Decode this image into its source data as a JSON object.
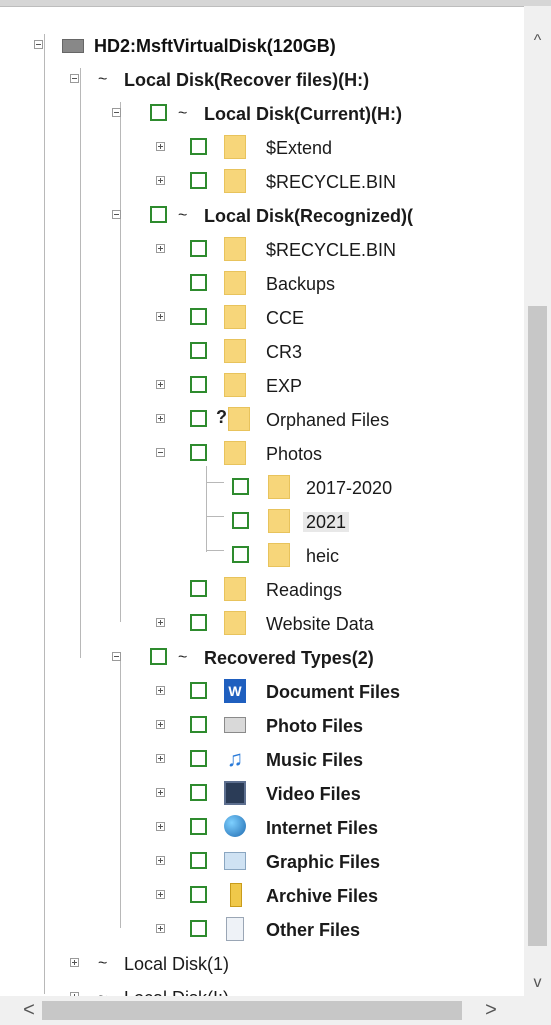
{
  "tree": {
    "root": {
      "label": "HD2:MsftVirtualDisk(120GB)"
    },
    "recover_files": {
      "label": "Local Disk(Recover files)(H:)"
    },
    "current": {
      "label": "Local Disk(Current)(H:)",
      "children": [
        "$Extend",
        "$RECYCLE.BIN"
      ]
    },
    "recognized": {
      "label": "Local Disk(Recognized)(",
      "children": [
        "$RECYCLE.BIN",
        "Backups",
        "CCE",
        "CR3",
        "EXP",
        "Orphaned Files",
        "Photos",
        "2017-2020",
        "2021",
        "heic",
        "Readings",
        "Website Data"
      ]
    },
    "recovered_types": {
      "label": "Recovered Types(2)",
      "children": [
        "Document Files",
        "Photo Files",
        "Music Files",
        "Video Files",
        "Internet Files",
        "Graphic Files",
        "Archive Files",
        "Other Files"
      ]
    },
    "disk1": {
      "label": "Local Disk(1)"
    },
    "diskI": {
      "label": "Local Disk(I:)"
    }
  },
  "icons": {
    "doc_glyph": "W",
    "music_glyph": "♫",
    "orphan_glyph": "?"
  },
  "scroll": {
    "up": "^",
    "down": "v",
    "left": "<",
    "right": ">"
  },
  "colors": {
    "orange": "#c45a16",
    "purple": "#6b4fe0",
    "pink": "#e040d0",
    "teal": "#1c8f6e",
    "checkbox": "#2e8b2e",
    "folder": "#f7d67a"
  }
}
